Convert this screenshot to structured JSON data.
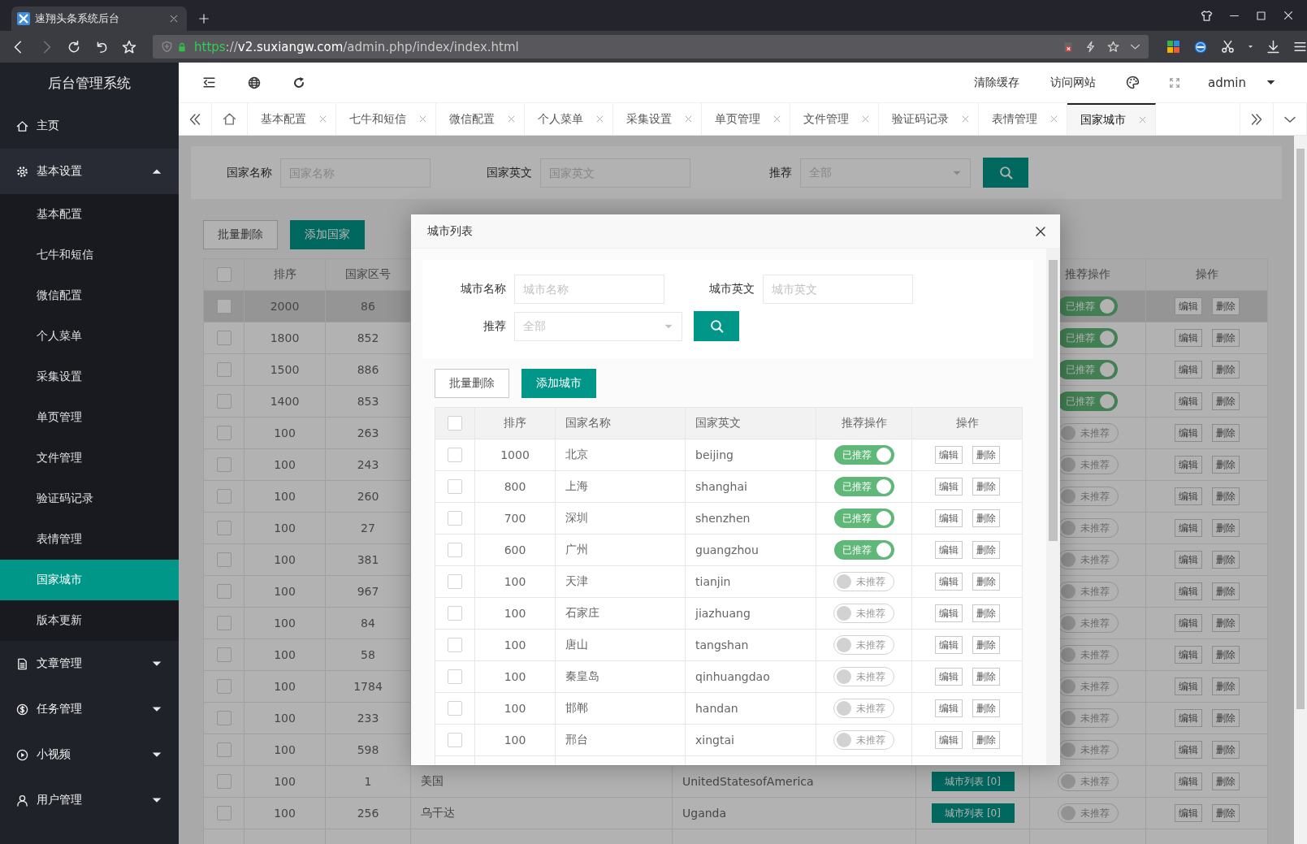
{
  "browser": {
    "tab_title": "速翔头条系统后台",
    "url": "https://v2.suxiangw.com/admin.php/index/index.html"
  },
  "sidebar": {
    "title": "后台管理系统",
    "items": [
      {
        "label": "主页",
        "kind": "link"
      },
      {
        "label": "基本设置",
        "kind": "menu",
        "expanded": true,
        "children": [
          {
            "label": "基本配置",
            "selected": false
          },
          {
            "label": "七牛和短信",
            "selected": false
          },
          {
            "label": "微信配置",
            "selected": false
          },
          {
            "label": "个人菜单",
            "selected": false
          },
          {
            "label": "采集设置",
            "selected": false
          },
          {
            "label": "单页管理",
            "selected": false
          },
          {
            "label": "文件管理",
            "selected": false
          },
          {
            "label": "验证码记录",
            "selected": false
          },
          {
            "label": "表情管理",
            "selected": false
          },
          {
            "label": "国家城市",
            "selected": true
          },
          {
            "label": "版本更新",
            "selected": false
          }
        ]
      },
      {
        "label": "文章管理",
        "kind": "menu",
        "expanded": false
      },
      {
        "label": "任务管理",
        "kind": "menu",
        "expanded": false
      },
      {
        "label": "小视频",
        "kind": "menu",
        "expanded": false
      },
      {
        "label": "用户管理",
        "kind": "menu",
        "expanded": false
      }
    ]
  },
  "header": {
    "links": [
      "清除缓存",
      "访问网站"
    ],
    "user": "admin"
  },
  "tabs": [
    {
      "label": "基本配置",
      "selected": false
    },
    {
      "label": "七牛和短信",
      "selected": false
    },
    {
      "label": "微信配置",
      "selected": false
    },
    {
      "label": "个人菜单",
      "selected": false
    },
    {
      "label": "采集设置",
      "selected": false
    },
    {
      "label": "单页管理",
      "selected": false
    },
    {
      "label": "文件管理",
      "selected": false
    },
    {
      "label": "验证码记录",
      "selected": false
    },
    {
      "label": "表情管理",
      "selected": false
    },
    {
      "label": "国家城市",
      "selected": true
    }
  ],
  "filters": [
    {
      "label": "国家名称",
      "kind": "input",
      "placeholder": "国家名称"
    },
    {
      "label": "国家英文",
      "kind": "input",
      "placeholder": "国家英文"
    },
    {
      "label": "推荐",
      "kind": "select",
      "placeholder": "全部"
    }
  ],
  "buttons": [
    {
      "label": "批量删除",
      "kind": "plain"
    },
    {
      "label": "添加国家",
      "kind": "primary"
    }
  ],
  "table": {
    "select_all": {
      "checked": false
    },
    "columns": [
      "排序",
      "国家区号",
      "推荐操作",
      "操作"
    ],
    "rows": [
      {
        "checked": false,
        "highlighted": true,
        "sort": "2000",
        "code": "86",
        "recommended": true,
        "recommend_label": "已推荐",
        "actions": [
          "编辑",
          "删除"
        ]
      },
      {
        "checked": false,
        "highlighted": false,
        "sort": "1800",
        "code": "852",
        "recommended": true,
        "recommend_label": "已推荐",
        "actions": [
          "编辑",
          "删除"
        ]
      },
      {
        "checked": false,
        "highlighted": false,
        "sort": "1500",
        "code": "886",
        "recommended": true,
        "recommend_label": "已推荐",
        "actions": [
          "编辑",
          "删除"
        ]
      },
      {
        "checked": false,
        "highlighted": false,
        "sort": "1400",
        "code": "853",
        "recommended": true,
        "recommend_label": "已推荐",
        "actions": [
          "编辑",
          "删除"
        ]
      },
      {
        "checked": false,
        "highlighted": false,
        "sort": "100",
        "code": "263",
        "recommended": false,
        "recommend_label": "未推荐",
        "actions": [
          "编辑",
          "删除"
        ]
      },
      {
        "checked": false,
        "highlighted": false,
        "sort": "100",
        "code": "243",
        "recommended": false,
        "recommend_label": "未推荐",
        "actions": [
          "编辑",
          "删除"
        ]
      },
      {
        "checked": false,
        "highlighted": false,
        "sort": "100",
        "code": "260",
        "recommended": false,
        "recommend_label": "未推荐",
        "actions": [
          "编辑",
          "删除"
        ]
      },
      {
        "checked": false,
        "highlighted": false,
        "sort": "100",
        "code": "27",
        "recommended": false,
        "recommend_label": "未推荐",
        "actions": [
          "编辑",
          "删除"
        ]
      },
      {
        "checked": false,
        "highlighted": false,
        "sort": "100",
        "code": "381",
        "recommended": false,
        "recommend_label": "未推荐",
        "actions": [
          "编辑",
          "删除"
        ]
      },
      {
        "checked": false,
        "highlighted": false,
        "sort": "100",
        "code": "967",
        "recommended": false,
        "recommend_label": "未推荐",
        "actions": [
          "编辑",
          "删除"
        ]
      },
      {
        "checked": false,
        "highlighted": false,
        "sort": "100",
        "code": "84",
        "recommended": false,
        "recommend_label": "未推荐",
        "actions": [
          "编辑",
          "删除"
        ]
      },
      {
        "checked": false,
        "highlighted": false,
        "sort": "100",
        "code": "58",
        "recommended": false,
        "recommend_label": "未推荐",
        "actions": [
          "编辑",
          "删除"
        ]
      },
      {
        "checked": false,
        "highlighted": false,
        "sort": "100",
        "code": "1784",
        "recommended": false,
        "recommend_label": "未推荐",
        "actions": [
          "编辑",
          "删除"
        ]
      },
      {
        "checked": false,
        "highlighted": false,
        "sort": "100",
        "code": "233",
        "recommended": false,
        "recommend_label": "未推荐",
        "actions": [
          "编辑",
          "删除"
        ]
      },
      {
        "checked": false,
        "highlighted": false,
        "sort": "100",
        "code": "598",
        "recommended": false,
        "recommend_label": "未推荐",
        "actions": [
          "编辑",
          "删除"
        ]
      },
      {
        "checked": false,
        "highlighted": false,
        "sort": "100",
        "code": "1",
        "name": "美国",
        "english": "UnitedStatesofAmerica",
        "cities": "城市列表 [0]",
        "recommended": false,
        "recommend_label": "未推荐",
        "actions": [
          "编辑",
          "删除"
        ]
      },
      {
        "checked": false,
        "highlighted": false,
        "sort": "100",
        "code": "256",
        "name": "乌干达",
        "english": "Uganda",
        "cities": "城市列表 [0]",
        "recommended": false,
        "recommend_label": "未推荐",
        "actions": [
          "编辑",
          "删除"
        ]
      }
    ]
  },
  "modal": {
    "title": "城市列表",
    "filters": [
      {
        "label": "城市名称",
        "kind": "input",
        "placeholder": "城市名称"
      },
      {
        "label": "城市英文",
        "kind": "input",
        "placeholder": "城市英文"
      },
      {
        "label": "推荐",
        "kind": "select",
        "placeholder": "全部"
      }
    ],
    "buttons": [
      {
        "label": "批量删除",
        "kind": "plain"
      },
      {
        "label": "添加城市",
        "kind": "primary"
      }
    ],
    "select_all": {
      "checked": false
    },
    "columns": [
      "排序",
      "国家名称",
      "国家英文",
      "推荐操作",
      "操作"
    ],
    "rows": [
      {
        "checked": false,
        "sort": "1000",
        "name": "北京",
        "english": "beijing",
        "recommended": true,
        "recommend_label": "已推荐",
        "actions": [
          "编辑",
          "删除"
        ]
      },
      {
        "checked": false,
        "sort": "800",
        "name": "上海",
        "english": "shanghai",
        "recommended": true,
        "recommend_label": "已推荐",
        "actions": [
          "编辑",
          "删除"
        ]
      },
      {
        "checked": false,
        "sort": "700",
        "name": "深圳",
        "english": "shenzhen",
        "recommended": true,
        "recommend_label": "已推荐",
        "actions": [
          "编辑",
          "删除"
        ]
      },
      {
        "checked": false,
        "sort": "600",
        "name": "广州",
        "english": "guangzhou",
        "recommended": true,
        "recommend_label": "已推荐",
        "actions": [
          "编辑",
          "删除"
        ]
      },
      {
        "checked": false,
        "sort": "100",
        "name": "天津",
        "english": "tianjin",
        "recommended": false,
        "recommend_label": "未推荐",
        "actions": [
          "编辑",
          "删除"
        ]
      },
      {
        "checked": false,
        "sort": "100",
        "name": "石家庄",
        "english": "jiazhuang",
        "recommended": false,
        "recommend_label": "未推荐",
        "actions": [
          "编辑",
          "删除"
        ]
      },
      {
        "checked": false,
        "sort": "100",
        "name": "唐山",
        "english": "tangshan",
        "recommended": false,
        "recommend_label": "未推荐",
        "actions": [
          "编辑",
          "删除"
        ]
      },
      {
        "checked": false,
        "sort": "100",
        "name": "秦皇岛",
        "english": "qinhuangdao",
        "recommended": false,
        "recommend_label": "未推荐",
        "actions": [
          "编辑",
          "删除"
        ]
      },
      {
        "checked": false,
        "sort": "100",
        "name": "邯郸",
        "english": "handan",
        "recommended": false,
        "recommend_label": "未推荐",
        "actions": [
          "编辑",
          "删除"
        ]
      },
      {
        "checked": false,
        "sort": "100",
        "name": "邢台",
        "english": "xingtai",
        "recommended": false,
        "recommend_label": "未推荐",
        "actions": [
          "编辑",
          "删除"
        ]
      }
    ]
  }
}
